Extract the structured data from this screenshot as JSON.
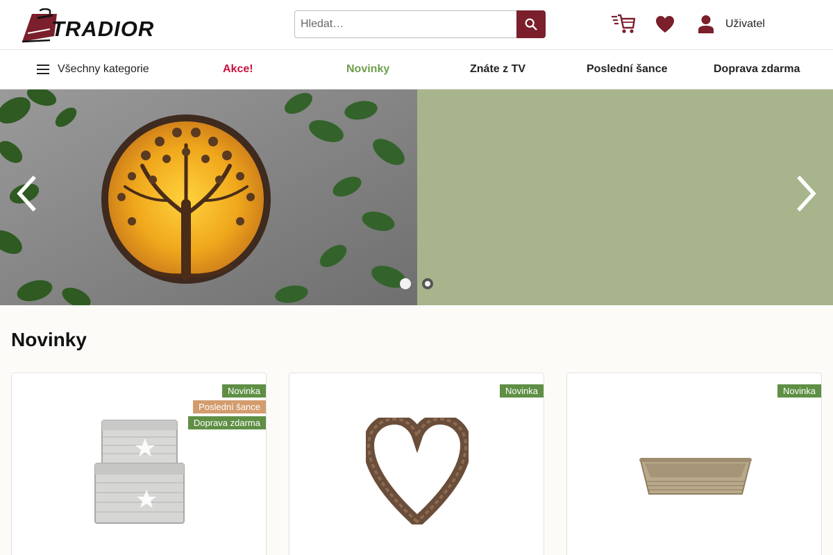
{
  "header": {
    "logo_text": "TRADIOR",
    "search": {
      "placeholder": "Hledat…",
      "value": ""
    },
    "search_icon": "search-icon",
    "cart_icon": "cart-icon",
    "favorites_icon": "heart-icon",
    "user_icon": "user-icon",
    "user_label": "Uživatel"
  },
  "nav": {
    "all_categories": "Všechny kategorie",
    "items": [
      {
        "label": "Akce!",
        "color": "#c8103e"
      },
      {
        "label": "Novinky",
        "color": "#6e9e4a"
      },
      {
        "label": "Znáte z TV",
        "color": "#222222"
      },
      {
        "label": "Poslední šance",
        "color": "#222222"
      },
      {
        "label": "Doprava zdarma",
        "color": "#222222"
      }
    ]
  },
  "hero": {
    "prev_icon": "chevron-left-icon",
    "next_icon": "chevron-right-icon",
    "slides_count": 2,
    "active_slide": 1
  },
  "section": {
    "title": "Novinky",
    "products": [
      {
        "badges": [
          "Novinka",
          "Poslední šance",
          "Doprava zdarma"
        ],
        "image": "wicker-baskets-image"
      },
      {
        "badges": [
          "Novinka"
        ],
        "image": "wicker-heart-image"
      },
      {
        "badges": [
          "Novinka"
        ],
        "image": "rattan-tray-image"
      }
    ]
  },
  "colors": {
    "brand": "#7a1f2b",
    "badge_new": "#5f8f45",
    "badge_last_chance": "#d29c6e",
    "badge_free_shipping": "#5f8f45"
  }
}
